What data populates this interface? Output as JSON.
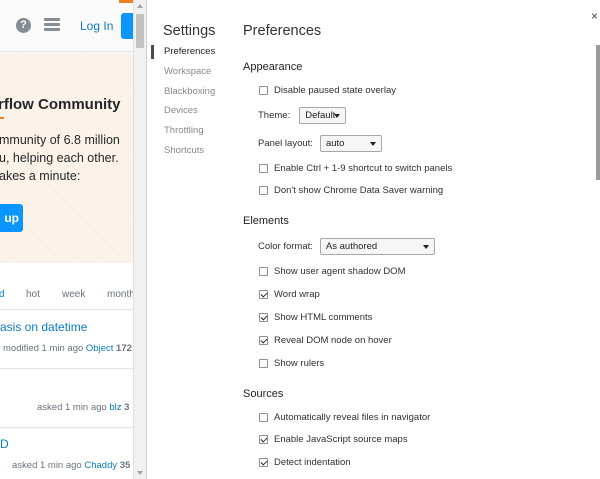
{
  "site": {
    "login_label": "Log In",
    "hero": {
      "title": "rflow Community",
      "lines": [
        "mmunity of 6.8 million",
        "u, helping each other.",
        "akes a minute:"
      ],
      "button_label": "up"
    },
    "tabs": [
      "d",
      "hot",
      "week",
      "month"
    ],
    "questions": [
      {
        "title": "asis on datetime",
        "meta_text": "modified 1 min ago",
        "user": "Object",
        "rep": "172"
      },
      {
        "title": "",
        "meta_text": "asked 1 min ago",
        "user": "blz",
        "rep": "3"
      },
      {
        "title": "D",
        "meta_text": "asked 1 min ago",
        "user": "Chaddy",
        "rep": "35"
      }
    ]
  },
  "devtools": {
    "close_label": "×",
    "settings_title": "Settings",
    "nav": [
      "Preferences",
      "Workspace",
      "Blackboxing",
      "Devices",
      "Throttling",
      "Shortcuts"
    ],
    "content_title": "Preferences",
    "appearance": {
      "heading": "Appearance",
      "disable_paused_overlay": "Disable paused state overlay",
      "theme_label": "Theme:",
      "theme_value": "Default",
      "panel_layout_label": "Panel layout:",
      "panel_layout_value": "auto",
      "ctrl_shortcut": "Enable Ctrl + 1-9 shortcut to switch panels",
      "data_saver_warning": "Don't show Chrome Data Saver warning"
    },
    "elements": {
      "heading": "Elements",
      "color_format_label": "Color format:",
      "color_format_value": "As authored",
      "user_agent_shadow_dom": "Show user agent shadow DOM",
      "word_wrap": "Word wrap",
      "html_comments": "Show HTML comments",
      "reveal_dom_node": "Reveal DOM node on hover",
      "show_rulers": "Show rulers"
    },
    "sources": {
      "heading": "Sources",
      "auto_reveal": "Automatically reveal files in navigator",
      "js_source_maps": "Enable JavaScript source maps",
      "detect_indentation": "Detect indentation"
    },
    "checked": {
      "disable_paused_overlay": false,
      "ctrl_shortcut": false,
      "data_saver_warning": false,
      "user_agent_shadow_dom": false,
      "word_wrap": true,
      "html_comments": true,
      "reveal_dom_node": true,
      "show_rulers": false,
      "auto_reveal": false,
      "js_source_maps": true,
      "detect_indentation": true
    }
  },
  "colors": {
    "link": "#0c7cc4",
    "brand_orange": "#f48024",
    "button_blue": "#0a95ff"
  },
  "icons": [
    "help-icon",
    "inbox-icon",
    "close-icon",
    "chevron-down-icon"
  ]
}
